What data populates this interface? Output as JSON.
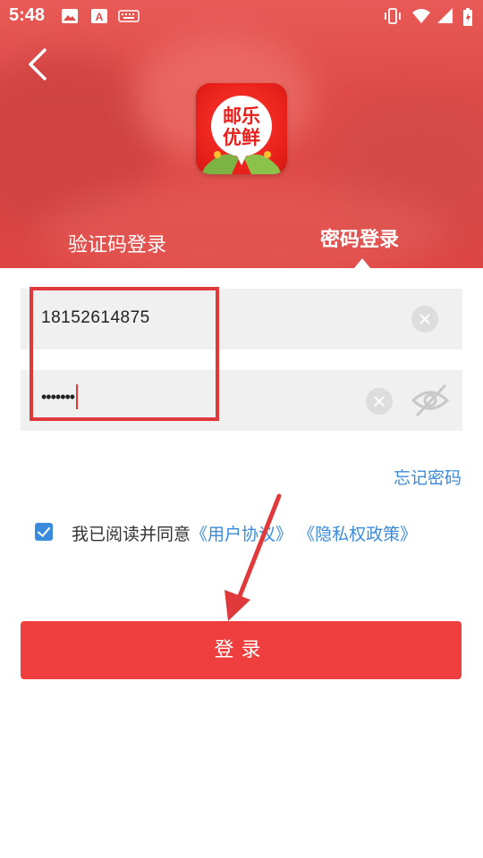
{
  "status_bar": {
    "time": "5:48",
    "left_icons": [
      "image-icon",
      "font-a-icon",
      "keyboard-icon"
    ],
    "right_icons": [
      "vibrate-icon",
      "wifi-icon",
      "signal-icon",
      "battery-charging-icon"
    ]
  },
  "header": {
    "back_icon": "back-arrow-icon",
    "logo_text_top": "邮乐",
    "logo_text_bottom": "优鲜",
    "tabs": [
      {
        "label": "验证码登录",
        "active": false
      },
      {
        "label": "密码登录",
        "active": true
      }
    ]
  },
  "form": {
    "phone_value": "18152614875",
    "password_mask": "•••••••",
    "clear_icon": "clear-icon",
    "visibility_icon": "eye-off-icon",
    "forgot_label": "忘记密码"
  },
  "agreement": {
    "checked": true,
    "prefix": "我已阅读并同意",
    "user_agreement": "《用户协议》",
    "privacy_policy": "《隐私权政策》"
  },
  "login_button": {
    "label": "登录"
  },
  "colors": {
    "header_red": "#df4b48",
    "login_red": "#ee3e3d",
    "link_blue": "#3b8bdc",
    "annotation_red": "#e0393c"
  }
}
